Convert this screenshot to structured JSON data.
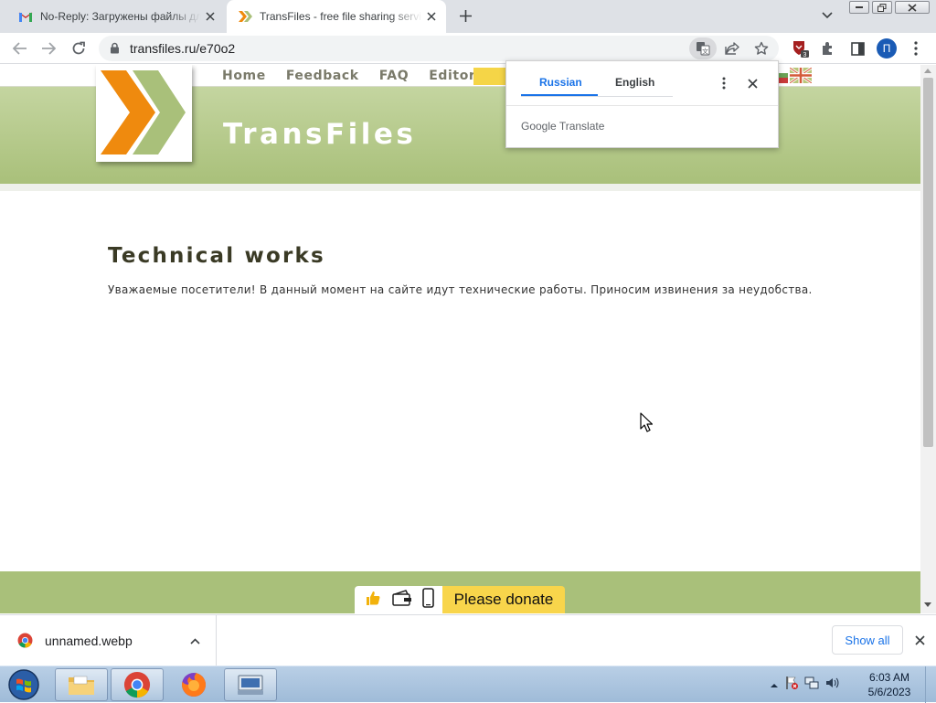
{
  "browser": {
    "tabs": [
      {
        "title": "No-Reply: Загружены файлы для",
        "state": "inactive"
      },
      {
        "title": "TransFiles - free file sharing service",
        "state": "active"
      }
    ],
    "url": "transfiles.ru/e70o2",
    "extension_badge": "3",
    "profile_initial": "П"
  },
  "site": {
    "nav": [
      "Home",
      "Feedback",
      "FAQ",
      "Editor"
    ],
    "title": "TransFiles",
    "brand_colors": {
      "orange": "#ef8a0e",
      "green": "#a9c07a"
    }
  },
  "content": {
    "heading": "Technical works",
    "message": "Уважаемые посетители! В данный момент на сайте идут технические работы. Приносим извинения за неудобства."
  },
  "footer": {
    "donate_label": "Please donate",
    "icons": [
      "thumbs-up-icon",
      "wallet-icon",
      "phone-icon"
    ]
  },
  "translate_popup": {
    "tab_source": "Russian",
    "tab_target": "English",
    "brand": "Google Translate"
  },
  "download_shelf": {
    "file_name": "unnamed.webp",
    "show_all": "Show all"
  },
  "taskbar": {
    "time": "6:03 AM",
    "date": "5/6/2023"
  }
}
